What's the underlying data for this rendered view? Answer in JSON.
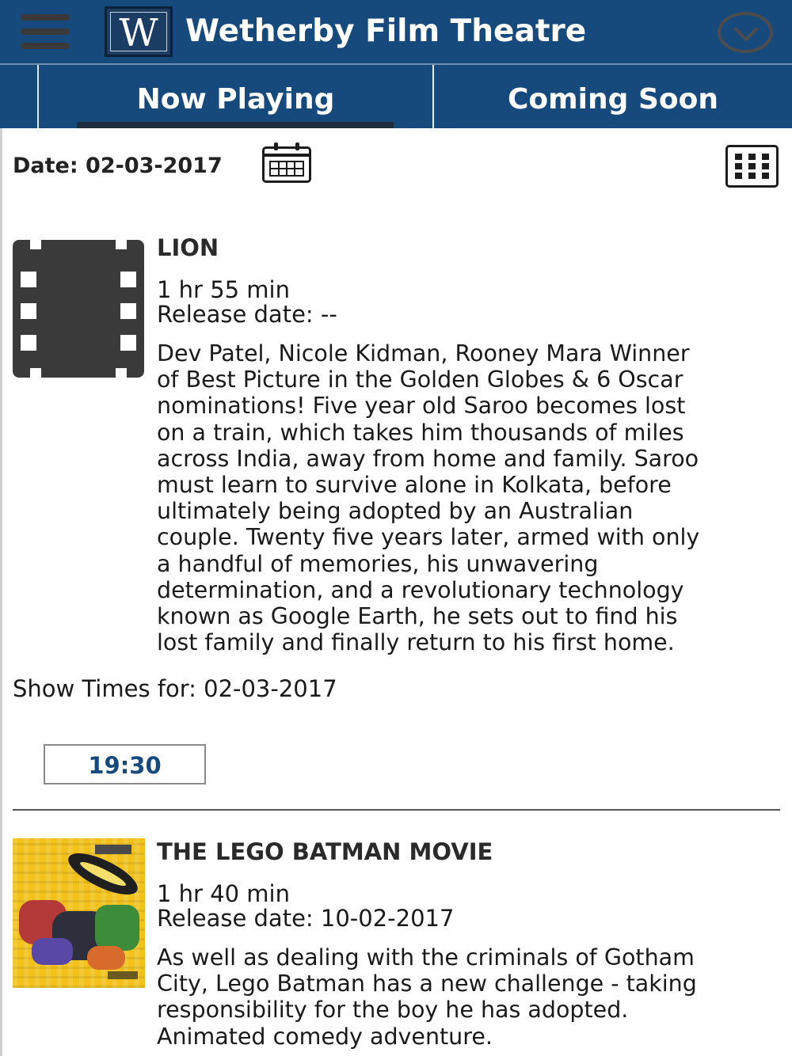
{
  "header": {
    "logo_letter": "W",
    "title": "Wetherby Film Theatre"
  },
  "tabs": [
    {
      "label": "Now Playing",
      "active": true
    },
    {
      "label": "Coming Soon",
      "active": false
    }
  ],
  "toolbar": {
    "date_label": "Date: 02-03-2017"
  },
  "movies": [
    {
      "title": "LION",
      "duration": "1 hr 55 min",
      "release": "Release date: --",
      "description_lines": [
        "Dev Patel, Nicole Kidman, Rooney Mara Winner",
        "of Best Picture in the Golden Globes & 6 Oscar",
        "nominations! Five year old Saroo becomes lost",
        "on a train, which takes him thousands of miles",
        "across India, away from home and family. Saroo",
        "must learn to survive alone in Kolkata, before",
        "ultimately being adopted by an Australian",
        "couple. Twenty five years later, armed with only",
        "a handful of memories, his unwavering",
        "determination, and a revolutionary technology",
        "known as Google Earth, he sets out to find his",
        "lost family and finally return to his first home."
      ],
      "show_times_label": "Show Times for: 02-03-2017",
      "show_times": [
        "19:30"
      ]
    },
    {
      "title": "THE LEGO BATMAN MOVIE",
      "duration": "1 hr 40 min",
      "release": "Release date: 10-02-2017",
      "description_lines": [
        "As well as dealing with the criminals of Gotham",
        "City, Lego Batman has a new challenge - taking",
        "responsibility for the boy he has adopted.",
        "Animated comedy adventure."
      ]
    }
  ],
  "colors": {
    "header_bg": "#174a7c",
    "time_text": "#174a7c"
  }
}
